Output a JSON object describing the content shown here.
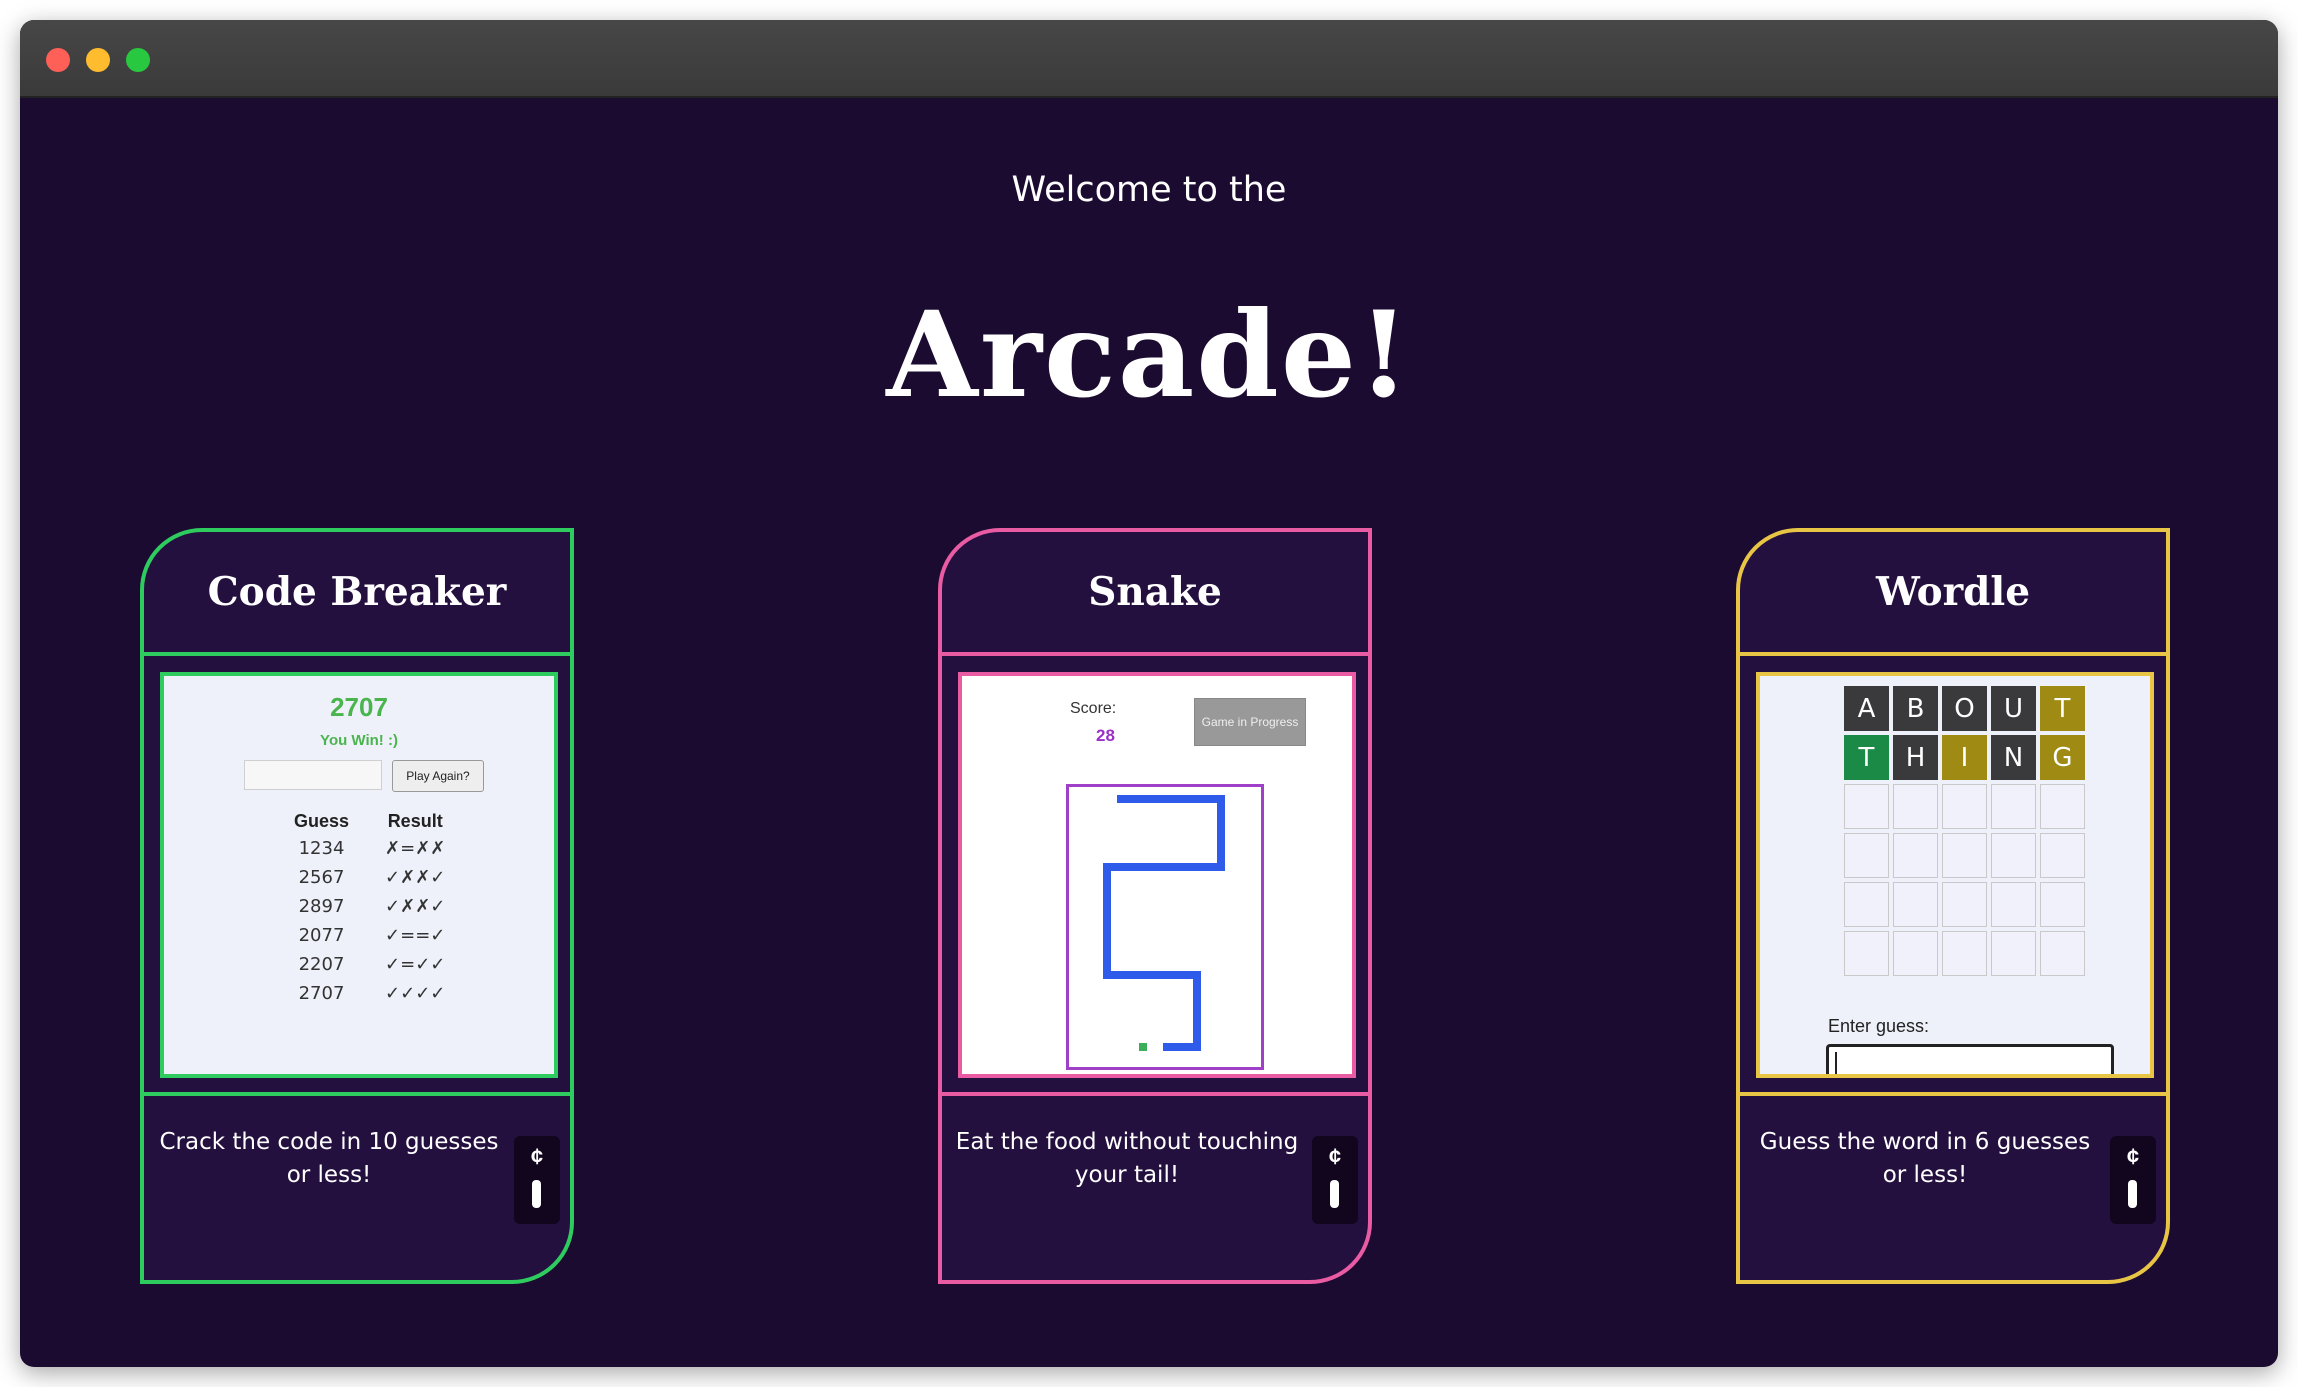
{
  "window": {
    "controls": [
      "close",
      "minimize",
      "maximize"
    ]
  },
  "hero": {
    "welcome": "Welcome to the",
    "title": "Arcade!"
  },
  "colors": {
    "background": "#1b0b30",
    "card_bg": "#24103f",
    "codebreaker": "#2ecc5f",
    "snake": "#e95ba3",
    "wordle": "#e8c545"
  },
  "cards": {
    "codebreaker": {
      "title": "Code Breaker",
      "description": "Crack the code in 10 guesses or less!",
      "coin_icon": "¢",
      "preview": {
        "answer": "2707",
        "status": "You Win! :)",
        "input_value": "",
        "button_label": "Play Again?",
        "headers": [
          "Guess",
          "Result"
        ],
        "rows": [
          [
            "1234",
            "✗=✗✗"
          ],
          [
            "2567",
            "✓✗✗✓"
          ],
          [
            "2897",
            "✓✗✗✓"
          ],
          [
            "2077",
            "✓==✓"
          ],
          [
            "2207",
            "✓=✓✓"
          ],
          [
            "2707",
            "✓✓✓✓"
          ]
        ]
      }
    },
    "snake": {
      "title": "Snake",
      "description": "Eat the food without touching your tail!",
      "coin_icon": "¢",
      "preview": {
        "score_label": "Score:",
        "score": "28",
        "button_label": "Game in Progress"
      }
    },
    "wordle": {
      "title": "Wordle",
      "description": "Guess the word in 6 guesses or less!",
      "coin_icon": "¢",
      "preview": {
        "rows": [
          [
            [
              "A",
              "gray"
            ],
            [
              "B",
              "gray"
            ],
            [
              "O",
              "gray"
            ],
            [
              "U",
              "gray"
            ],
            [
              "T",
              "yellow"
            ]
          ],
          [
            [
              "T",
              "green"
            ],
            [
              "H",
              "gray"
            ],
            [
              "I",
              "yellow"
            ],
            [
              "N",
              "gray"
            ],
            [
              "G",
              "yellow"
            ]
          ],
          [
            [
              "",
              ""
            ],
            [
              "",
              ""
            ],
            [
              "",
              ""
            ],
            [
              "",
              ""
            ],
            [
              "",
              ""
            ]
          ],
          [
            [
              "",
              ""
            ],
            [
              "",
              ""
            ],
            [
              "",
              ""
            ],
            [
              "",
              ""
            ],
            [
              "",
              ""
            ]
          ],
          [
            [
              "",
              ""
            ],
            [
              "",
              ""
            ],
            [
              "",
              ""
            ],
            [
              "",
              ""
            ],
            [
              "",
              ""
            ]
          ],
          [
            [
              "",
              ""
            ],
            [
              "",
              ""
            ],
            [
              "",
              ""
            ],
            [
              "",
              ""
            ],
            [
              "",
              ""
            ]
          ]
        ],
        "input_label": "Enter guess:",
        "input_value": ""
      }
    }
  }
}
